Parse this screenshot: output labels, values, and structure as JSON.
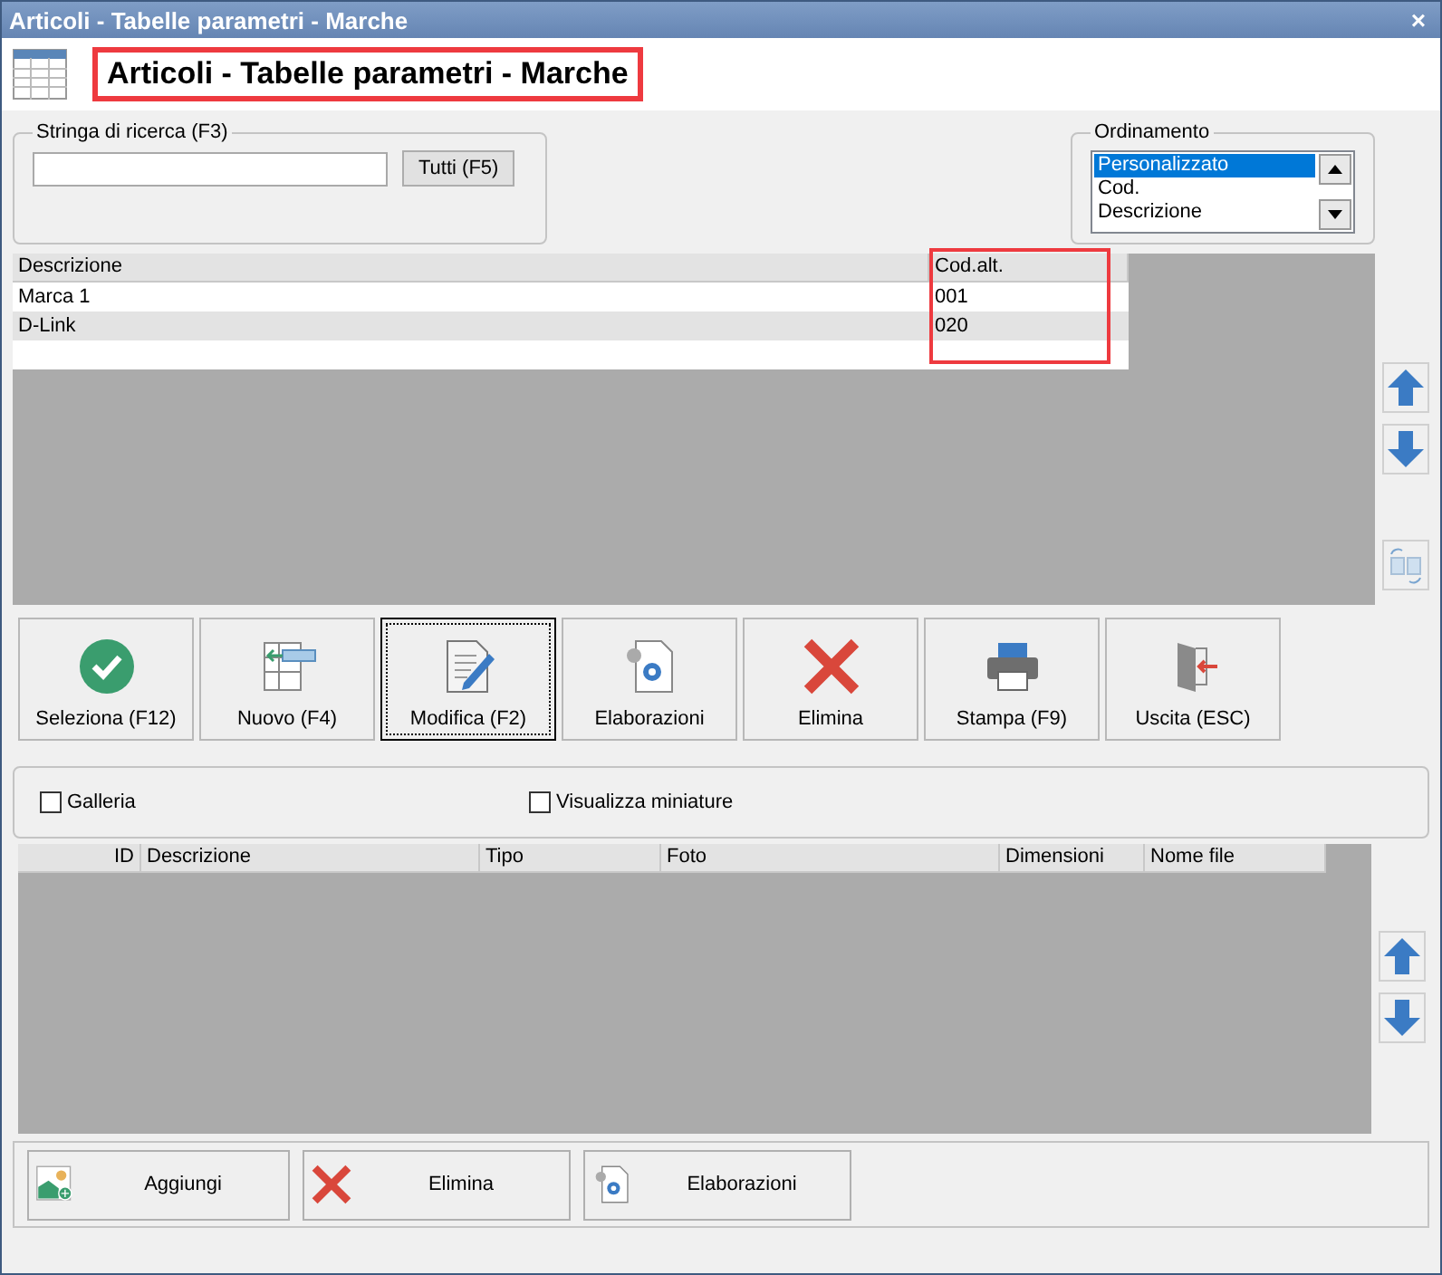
{
  "window": {
    "title": "Articoli - Tabelle parametri - Marche",
    "close": "×"
  },
  "header": {
    "title": "Articoli - Tabelle parametri - Marche",
    "highlighted": true
  },
  "search": {
    "label": "Stringa di ricerca (F3)",
    "button": "Tutti (F5)"
  },
  "sort": {
    "label": "Ordinamento",
    "options": [
      {
        "label": "Personalizzato",
        "selected": true
      },
      {
        "label": "Cod.",
        "selected": false
      },
      {
        "label": "Descrizione",
        "selected": false
      }
    ]
  },
  "table": {
    "columns": [
      {
        "label": "Descrizione",
        "highlighted": false
      },
      {
        "label": "Cod.alt.",
        "highlighted": true
      }
    ],
    "rows": [
      [
        "Marca 1",
        "001"
      ],
      [
        "D-Link",
        "020"
      ]
    ]
  },
  "toolbar": [
    {
      "label": "Seleziona (F12)",
      "kind": "check",
      "focused": false
    },
    {
      "label": "Nuovo (F4)",
      "kind": "new",
      "focused": false
    },
    {
      "label": "Modifica (F2)",
      "kind": "edit",
      "focused": true
    },
    {
      "label": "Elaborazioni",
      "kind": "process",
      "focused": false
    },
    {
      "label": "Elimina",
      "kind": "delete",
      "focused": false
    },
    {
      "label": "Stampa (F9)",
      "kind": "print",
      "focused": false
    },
    {
      "label": "Uscita (ESC)",
      "kind": "exit",
      "focused": false
    }
  ],
  "options": [
    {
      "label": "Galleria",
      "checked": false
    },
    {
      "label": "Visualizza miniature",
      "checked": false
    }
  ],
  "images": {
    "columns": [
      "ID",
      "Descrizione",
      "Tipo",
      "Foto",
      "Dimensioni",
      "Nome file"
    ]
  },
  "image_actions": [
    {
      "label": "Aggiungi",
      "kind": "add"
    },
    {
      "label": "Elimina",
      "kind": "delete"
    },
    {
      "label": "Elaborazioni",
      "kind": "process"
    }
  ]
}
